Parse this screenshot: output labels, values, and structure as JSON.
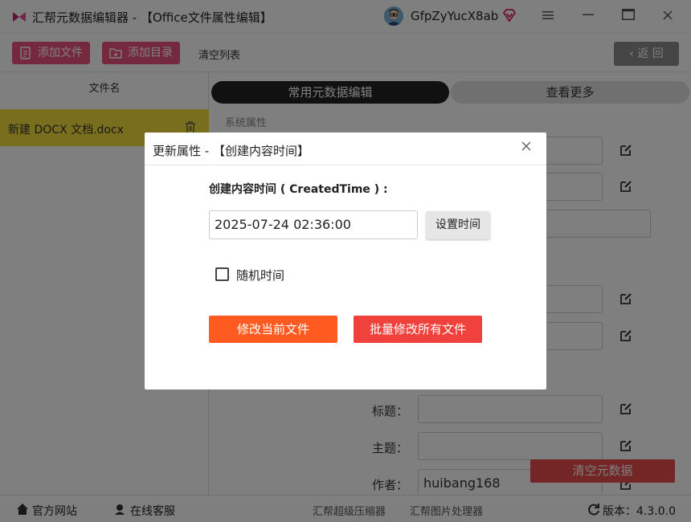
{
  "titlebar": {
    "app_title": "汇帮元数据编辑器 - 【Office文件属性编辑】",
    "username": "GfpZyYucX8ab"
  },
  "toolbar": {
    "add_file": "添加文件",
    "add_dir": "添加目录",
    "clear_list": "清空列表",
    "back": "返 回"
  },
  "file_list": {
    "header": "文件名",
    "items": [
      {
        "name": "新建 DOCX 文档.docx"
      }
    ]
  },
  "tabs": {
    "common": "常用元数据编辑",
    "more": "查看更多"
  },
  "main": {
    "section_label": "系统属性",
    "fields": [
      {
        "label": "标题：",
        "value": ""
      },
      {
        "label": "主题：",
        "value": ""
      },
      {
        "label": "作者：",
        "value": "huibang168"
      }
    ],
    "clear_metadata": "清空元数据"
  },
  "statusbar": {
    "website": "官方网站",
    "support": "在线客服",
    "compressor": "汇帮超级压缩器",
    "image_tool": "汇帮图片处理器",
    "version": "版本：4.3.0.0"
  },
  "dialog": {
    "title": "更新属性 - 【创建内容时间】",
    "field_label": "创建内容时间 ( CreatedTime ) :",
    "time_value": "2025-07-24 02:36:00",
    "set_time": "设置时间",
    "random_time": "随机时间",
    "random_checked": false,
    "modify_current": "修改当前文件",
    "modify_all": "批量修改所有文件"
  },
  "colors": {
    "pink": "#e8527e",
    "highlight": "#f2dd3c",
    "orange": "#ff5a1f",
    "red": "#f0413c"
  }
}
